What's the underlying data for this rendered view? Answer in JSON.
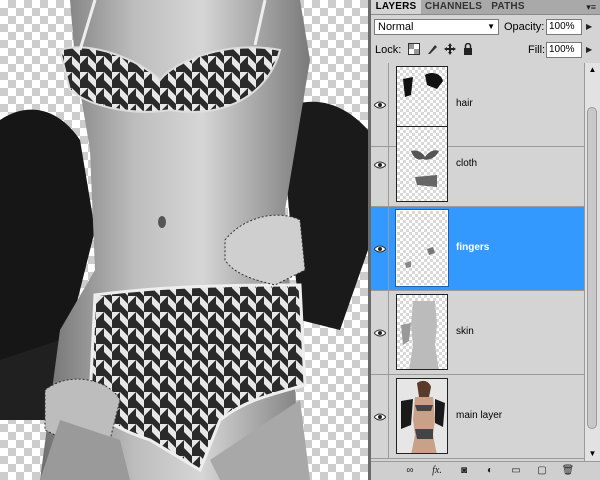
{
  "panel": {
    "tabs": [
      {
        "label": "LAYERS",
        "active": true
      },
      {
        "label": "CHANNELS",
        "active": false
      },
      {
        "label": "PATHS",
        "active": false
      }
    ],
    "blend_mode": "Normal",
    "opacity_label": "Opacity:",
    "opacity_value": "100%",
    "lock_label": "Lock:",
    "fill_label": "Fill:",
    "fill_value": "100%",
    "layers": [
      {
        "name": "hair",
        "visible": true,
        "selected": false
      },
      {
        "name": "cloth",
        "visible": true,
        "selected": false
      },
      {
        "name": "fingers",
        "visible": true,
        "selected": true
      },
      {
        "name": "skin",
        "visible": true,
        "selected": false
      },
      {
        "name": "main layer",
        "visible": true,
        "selected": false
      }
    ],
    "fx_label": "fx.",
    "selection_color": "#3399ff"
  }
}
